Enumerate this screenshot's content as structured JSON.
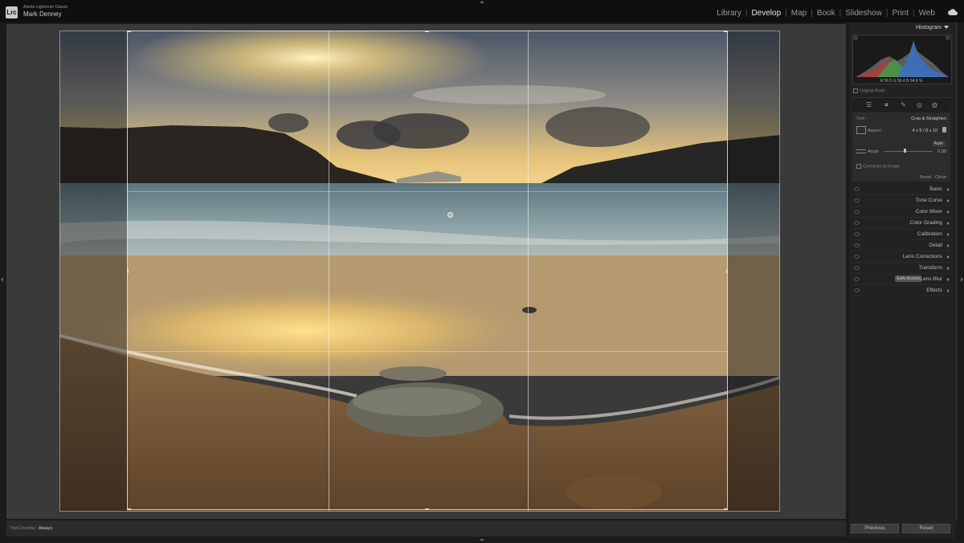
{
  "app": {
    "name": "Adobe Lightroom Classic",
    "user": "Mark Denney",
    "logo_text": "Lrc"
  },
  "modules": [
    {
      "label": "Library",
      "active": false
    },
    {
      "label": "Develop",
      "active": true
    },
    {
      "label": "Map",
      "active": false
    },
    {
      "label": "Book",
      "active": false
    },
    {
      "label": "Slideshow",
      "active": false
    },
    {
      "label": "Print",
      "active": false
    },
    {
      "label": "Web",
      "active": false
    }
  ],
  "toolbar": {
    "tool_overlay_label": "Tool Overlay :",
    "tool_overlay_value": "Always"
  },
  "histogram": {
    "title": "Histogram",
    "r_label": "R",
    "r_value": "56.5",
    "g_label": "G",
    "g_value": "56.4",
    "b_label": "B",
    "b_value": "54.8",
    "unit": "%",
    "original_photo": "Original Photo"
  },
  "crop": {
    "tool_label": "Tool :",
    "tool_value": "Crop & Straighten",
    "aspect_label": "Aspect :",
    "aspect_value": "4 x 5  /  8 x 10",
    "auto": "Auto",
    "angle_label": "Angle",
    "angle_value": "0.00",
    "constrain": "Constrain to image",
    "reset": "Reset",
    "close": "Close"
  },
  "sections": [
    {
      "label": "Basic",
      "badge": ""
    },
    {
      "label": "Tone Curve",
      "badge": ""
    },
    {
      "label": "Color Mixer",
      "badge": ""
    },
    {
      "label": "Color Grading",
      "badge": ""
    },
    {
      "label": "Calibration",
      "badge": ""
    },
    {
      "label": "Detail",
      "badge": ""
    },
    {
      "label": "Lens Corrections",
      "badge": ""
    },
    {
      "label": "Transform",
      "badge": ""
    },
    {
      "label": "Lens Blur",
      "badge": "Early Access"
    },
    {
      "label": "Effects",
      "badge": ""
    }
  ],
  "buttons": {
    "previous": "Previous",
    "reset": "Reset"
  },
  "icons": {
    "cloud": "cloud-icon",
    "basic_tool": "sliders-icon",
    "crop_tool": "crop-icon",
    "heal_tool": "healing-brush-icon",
    "redeye_tool": "red-eye-icon",
    "mask_tool": "masking-icon"
  },
  "colors": {
    "topbar": "#0f0f0f",
    "canvas": "#3a3a3a",
    "panel": "#222222",
    "active_module": "#e6e6e6"
  }
}
